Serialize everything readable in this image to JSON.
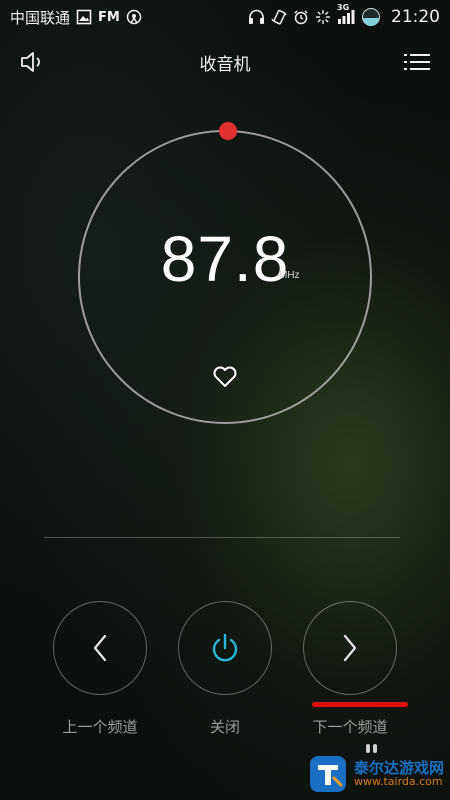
{
  "status_bar": {
    "carrier": "中国联通",
    "fm_label": "FM",
    "network_tag": "3G",
    "time": "21:20",
    "icons": [
      "image-icon",
      "broadcast-icon",
      "headphone-icon",
      "vibrate-icon",
      "alarm-icon",
      "sync-icon",
      "signal-icon",
      "battery-icon"
    ]
  },
  "header": {
    "title": "收音机",
    "left_icon": "speaker-icon",
    "right_icon": "menu-icon"
  },
  "tuner": {
    "frequency": "87.8",
    "unit": "MHz",
    "marker_color": "#e0302f",
    "favorite_icon": "heart-outline-icon"
  },
  "controls": {
    "prev_label": "上一个频道",
    "power_label": "关闭",
    "next_label": "下一个频道",
    "power_color": "#29b6d6",
    "highlight_color": "#e01010"
  },
  "watermark": {
    "name": "泰尔达游戏网",
    "url": "www.tairda.com"
  }
}
